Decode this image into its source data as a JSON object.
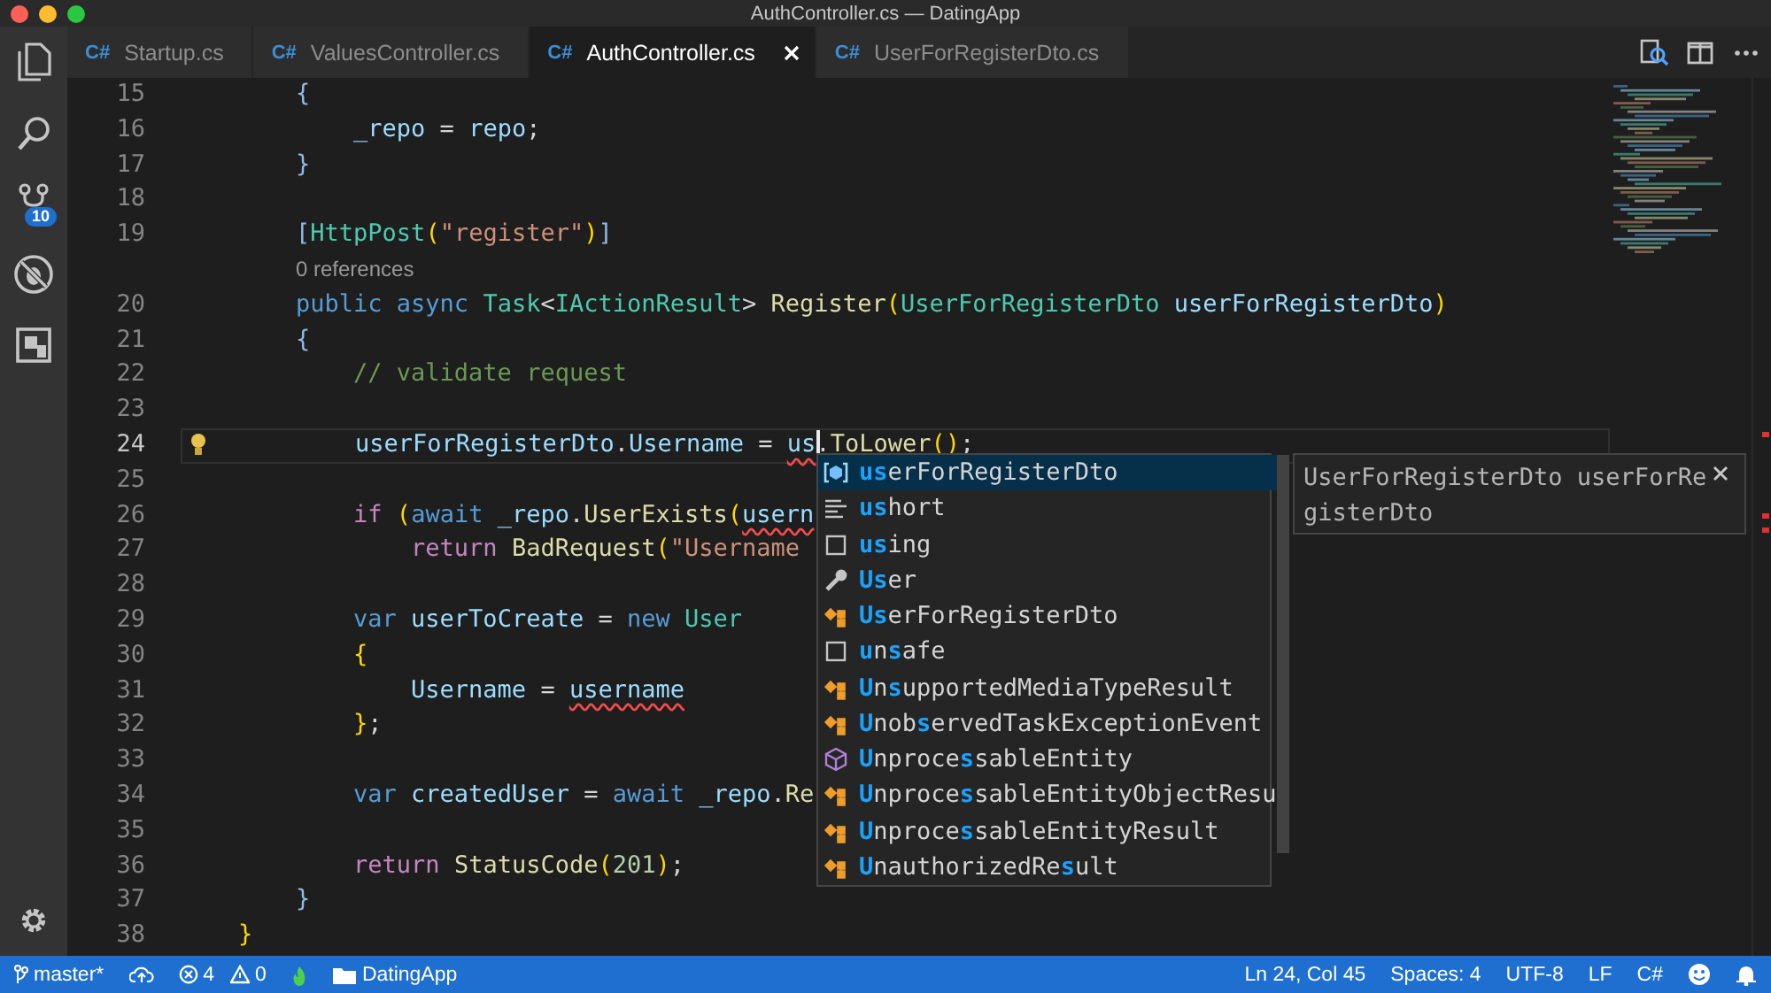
{
  "window": {
    "title": "AuthController.cs — DatingApp"
  },
  "activity_bar": {
    "items": [
      {
        "kind": "explorer"
      },
      {
        "kind": "search"
      },
      {
        "kind": "source-control",
        "badge": "10"
      },
      {
        "kind": "debug"
      },
      {
        "kind": "extensions"
      }
    ],
    "bottom": [
      {
        "kind": "settings"
      }
    ]
  },
  "tabs": [
    {
      "icon": "C#",
      "label": "Startup.cs",
      "selected": false
    },
    {
      "icon": "C#",
      "label": "ValuesController.cs",
      "selected": false
    },
    {
      "icon": "C#",
      "label": "AuthController.cs",
      "selected": true
    },
    {
      "icon": "C#",
      "label": "UserForRegisterDto.cs",
      "selected": false
    }
  ],
  "editor": {
    "lines": [
      {
        "kind": "code",
        "number": "15",
        "current": false,
        "tokens": [
          {
            "kind": "bracket",
            "text": "        {"
          }
        ]
      },
      {
        "kind": "code",
        "number": "16",
        "current": false,
        "tokens": [
          {
            "kind": "variable",
            "text": "            _repo"
          },
          {
            "kind": "plain",
            "text": " = "
          },
          {
            "kind": "variable",
            "text": "repo"
          },
          {
            "kind": "plain",
            "text": ";"
          }
        ]
      },
      {
        "kind": "code",
        "number": "17",
        "current": false,
        "tokens": [
          {
            "kind": "bracket",
            "text": "        }"
          }
        ]
      },
      {
        "kind": "code",
        "number": "18",
        "current": false
      },
      {
        "kind": "code",
        "number": "19",
        "current": false,
        "tokens": [
          {
            "kind": "bracket",
            "text": "        ["
          },
          {
            "kind": "type",
            "text": "HttpPost"
          },
          {
            "kind": "bracket2",
            "text": "("
          },
          {
            "kind": "string",
            "text": "\"register\""
          },
          {
            "kind": "bracket2",
            "text": ")"
          },
          {
            "kind": "bracket",
            "text": "]"
          }
        ]
      },
      {
        "kind": "codelens",
        "text": "0 references"
      },
      {
        "kind": "code",
        "number": "20",
        "current": false,
        "tokens": [
          {
            "kind": "keyword",
            "text": "        public "
          },
          {
            "kind": "keyword",
            "text": "async "
          },
          {
            "kind": "type",
            "text": "Task"
          },
          {
            "kind": "plain",
            "text": "<"
          },
          {
            "kind": "type",
            "text": "IActionResult"
          },
          {
            "kind": "plain",
            "text": "> "
          },
          {
            "kind": "function",
            "text": "Register"
          },
          {
            "kind": "bracket2",
            "text": "("
          },
          {
            "kind": "type",
            "text": "UserForRegisterDto "
          },
          {
            "kind": "variable",
            "text": "userForRegisterDto"
          },
          {
            "kind": "bracket2",
            "text": ")"
          }
        ]
      },
      {
        "kind": "code",
        "number": "21",
        "current": false,
        "tokens": [
          {
            "kind": "bracket",
            "text": "        {"
          }
        ]
      },
      {
        "kind": "code",
        "number": "22",
        "current": false,
        "tokens": [
          {
            "kind": "comment",
            "text": "            // validate request"
          }
        ]
      },
      {
        "kind": "code",
        "number": "23",
        "current": false
      },
      {
        "kind": "code",
        "number": "24",
        "current": true,
        "lightbulb": true,
        "tokens": [
          {
            "kind": "variable",
            "text": "            userForRegisterDto"
          },
          {
            "kind": "plain",
            "text": "."
          },
          {
            "kind": "variable",
            "text": "Username"
          },
          {
            "kind": "plain",
            "text": " = "
          },
          {
            "kind": "variable",
            "text": "us",
            "error": true,
            "cursor": true
          },
          {
            "kind": "plain",
            "text": "."
          },
          {
            "kind": "function",
            "text": "ToLower"
          },
          {
            "kind": "bracket2",
            "text": "()"
          },
          {
            "kind": "plain",
            "text": ";"
          }
        ]
      },
      {
        "kind": "code",
        "number": "25",
        "current": false
      },
      {
        "kind": "code",
        "number": "26",
        "current": false,
        "tokens": [
          {
            "kind": "control",
            "text": "            if "
          },
          {
            "kind": "bracket2",
            "text": "("
          },
          {
            "kind": "keyword",
            "text": "await "
          },
          {
            "kind": "variable",
            "text": "_repo"
          },
          {
            "kind": "plain",
            "text": "."
          },
          {
            "kind": "function",
            "text": "UserExists"
          },
          {
            "kind": "bracket2",
            "text": "("
          },
          {
            "kind": "variable",
            "text": "usern",
            "error": true
          }
        ]
      },
      {
        "kind": "code",
        "number": "27",
        "current": false,
        "tokens": [
          {
            "kind": "control",
            "text": "                return "
          },
          {
            "kind": "function",
            "text": "BadRequest"
          },
          {
            "kind": "bracket2",
            "text": "("
          },
          {
            "kind": "string",
            "text": "\"Username"
          }
        ]
      },
      {
        "kind": "code",
        "number": "28",
        "current": false
      },
      {
        "kind": "code",
        "number": "29",
        "current": false,
        "tokens": [
          {
            "kind": "keyword",
            "text": "            var "
          },
          {
            "kind": "variable",
            "text": "userToCreate"
          },
          {
            "kind": "plain",
            "text": " = "
          },
          {
            "kind": "keyword",
            "text": "new "
          },
          {
            "kind": "type",
            "text": "User"
          }
        ]
      },
      {
        "kind": "code",
        "number": "30",
        "current": false,
        "tokens": [
          {
            "kind": "bracket2",
            "text": "            {"
          }
        ]
      },
      {
        "kind": "code",
        "number": "31",
        "current": false,
        "tokens": [
          {
            "kind": "variable",
            "text": "                Username"
          },
          {
            "kind": "plain",
            "text": " = "
          },
          {
            "kind": "variable",
            "text": "username",
            "error": true
          }
        ]
      },
      {
        "kind": "code",
        "number": "32",
        "current": false,
        "tokens": [
          {
            "kind": "bracket2",
            "text": "            }"
          },
          {
            "kind": "plain",
            "text": ";"
          }
        ]
      },
      {
        "kind": "code",
        "number": "33",
        "current": false
      },
      {
        "kind": "code",
        "number": "34",
        "current": false,
        "tokens": [
          {
            "kind": "keyword",
            "text": "            var "
          },
          {
            "kind": "variable",
            "text": "createdUser"
          },
          {
            "kind": "plain",
            "text": " = "
          },
          {
            "kind": "keyword",
            "text": "await "
          },
          {
            "kind": "variable",
            "text": "_repo"
          },
          {
            "kind": "plain",
            "text": "."
          },
          {
            "kind": "function",
            "text": "Re"
          }
        ]
      },
      {
        "kind": "code",
        "number": "35",
        "current": false
      },
      {
        "kind": "code",
        "number": "36",
        "current": false,
        "tokens": [
          {
            "kind": "control",
            "text": "            return "
          },
          {
            "kind": "function",
            "text": "StatusCode"
          },
          {
            "kind": "bracket2",
            "text": "("
          },
          {
            "kind": "number",
            "text": "201"
          },
          {
            "kind": "bracket2",
            "text": ")"
          },
          {
            "kind": "plain",
            "text": ";"
          }
        ]
      },
      {
        "kind": "code",
        "number": "37",
        "current": false,
        "tokens": [
          {
            "kind": "bracket",
            "text": "        }"
          }
        ]
      },
      {
        "kind": "code",
        "number": "38",
        "current": false,
        "tokens": [
          {
            "kind": "bracket2",
            "text": "    }"
          }
        ]
      }
    ],
    "suggest": {
      "items": [
        {
          "kind": "field",
          "selected": true,
          "parts": [
            {
              "t": "us",
              "match": true
            },
            {
              "t": "erForRegisterDto",
              "match": false
            }
          ]
        },
        {
          "kind": "keyword-type",
          "selected": false,
          "parts": [
            {
              "t": "us",
              "match": true
            },
            {
              "t": "hort",
              "match": false
            }
          ]
        },
        {
          "kind": "keyword",
          "selected": false,
          "parts": [
            {
              "t": "us",
              "match": true
            },
            {
              "t": "ing",
              "match": false
            }
          ]
        },
        {
          "kind": "property",
          "selected": false,
          "parts": [
            {
              "t": "Us",
              "match": true
            },
            {
              "t": "er",
              "match": false
            }
          ]
        },
        {
          "kind": "class",
          "selected": false,
          "parts": [
            {
              "t": "Us",
              "match": true
            },
            {
              "t": "erForRegisterDto",
              "match": false
            }
          ]
        },
        {
          "kind": "keyword",
          "selected": false,
          "parts": [
            {
              "t": "u",
              "match": true
            },
            {
              "t": "n",
              "match": false
            },
            {
              "t": "s",
              "match": true
            },
            {
              "t": "afe",
              "match": false
            }
          ]
        },
        {
          "kind": "class",
          "selected": false,
          "parts": [
            {
              "t": "U",
              "match": true
            },
            {
              "t": "n",
              "match": false
            },
            {
              "t": "s",
              "match": true
            },
            {
              "t": "upportedMediaTypeResult",
              "match": false
            }
          ]
        },
        {
          "kind": "class",
          "selected": false,
          "parts": [
            {
              "t": "U",
              "match": true
            },
            {
              "t": "nob",
              "match": false
            },
            {
              "t": "s",
              "match": true
            },
            {
              "t": "ervedTaskExceptionEvent",
              "match": false
            }
          ]
        },
        {
          "kind": "module",
          "selected": false,
          "parts": [
            {
              "t": "U",
              "match": true
            },
            {
              "t": "nproce",
              "match": false
            },
            {
              "t": "s",
              "match": true
            },
            {
              "t": "sableEntity",
              "match": false
            }
          ]
        },
        {
          "kind": "class",
          "selected": false,
          "parts": [
            {
              "t": "U",
              "match": true
            },
            {
              "t": "nproce",
              "match": false
            },
            {
              "t": "s",
              "match": true
            },
            {
              "t": "sableEntityObjectResu",
              "match": false
            }
          ]
        },
        {
          "kind": "class",
          "selected": false,
          "parts": [
            {
              "t": "U",
              "match": true
            },
            {
              "t": "nproce",
              "match": false
            },
            {
              "t": "s",
              "match": true
            },
            {
              "t": "sableEntityResult",
              "match": false
            }
          ]
        },
        {
          "kind": "class",
          "selected": false,
          "parts": [
            {
              "t": "U",
              "match": true
            },
            {
              "t": "nauthorizedRe",
              "match": false
            },
            {
              "t": "s",
              "match": true
            },
            {
              "t": "ult",
              "match": false
            }
          ]
        }
      ],
      "details": "UserForRegisterDto userForRegisterDto"
    }
  },
  "status_bar": {
    "left": [
      {
        "kind": "branch",
        "text": "master*"
      },
      {
        "kind": "sync"
      },
      {
        "kind": "problems",
        "errors": "4",
        "warnings": "0"
      },
      {
        "kind": "flame"
      },
      {
        "kind": "folder",
        "text": "DatingApp"
      }
    ],
    "right": [
      {
        "kind": "text",
        "text": "Ln 24, Col 45"
      },
      {
        "kind": "text",
        "text": "Spaces: 4"
      },
      {
        "kind": "text",
        "text": "UTF-8"
      },
      {
        "kind": "text",
        "text": "LF"
      },
      {
        "kind": "text",
        "text": "C#"
      },
      {
        "kind": "feedback"
      },
      {
        "kind": "bell"
      }
    ]
  }
}
